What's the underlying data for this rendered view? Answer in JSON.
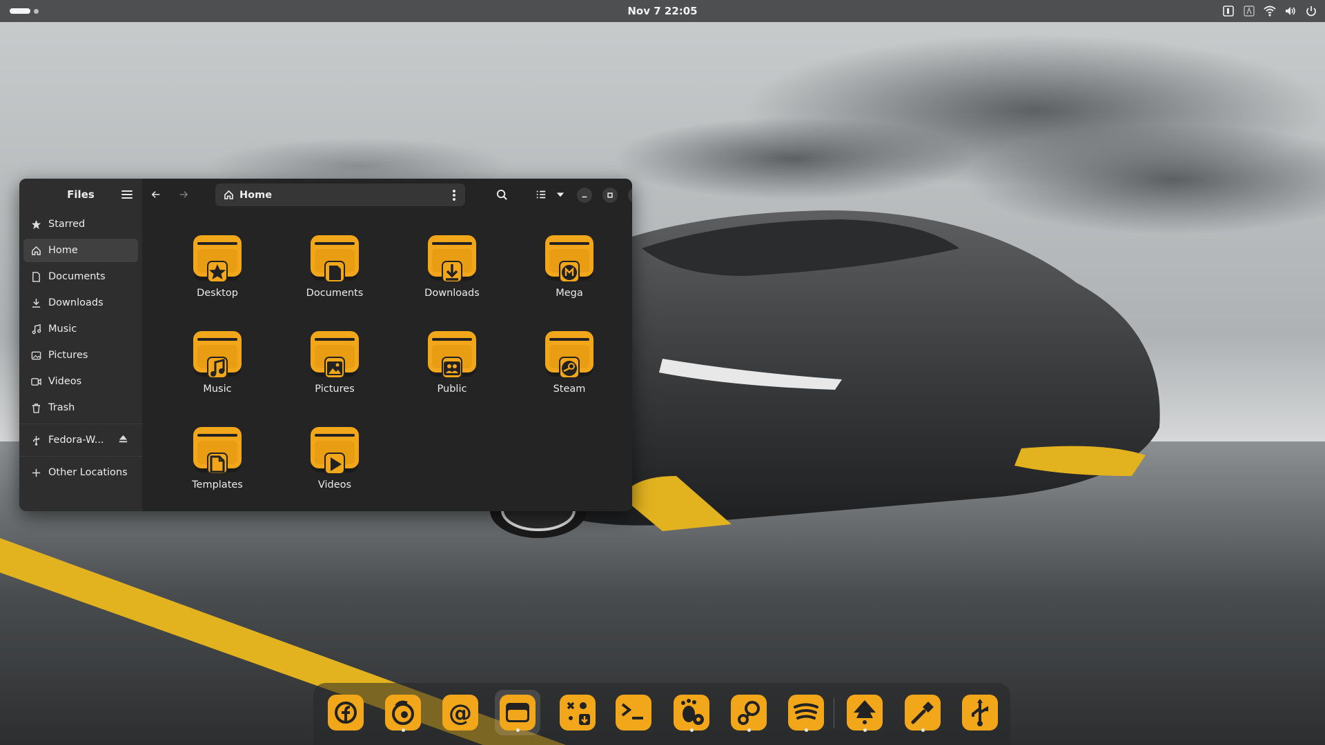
{
  "topbar": {
    "clock": "Nov 7  22:05",
    "tray_icons": [
      "keyboard-layout-icon",
      "input-method-icon",
      "wifi-icon",
      "volume-icon",
      "power-icon"
    ]
  },
  "files": {
    "title": "Files",
    "location": "Home",
    "sidebar": [
      {
        "label": "Starred",
        "icon": "star-icon"
      },
      {
        "label": "Home",
        "icon": "home-icon",
        "active": true
      },
      {
        "label": "Documents",
        "icon": "document-icon"
      },
      {
        "label": "Downloads",
        "icon": "download-icon"
      },
      {
        "label": "Music",
        "icon": "music-icon"
      },
      {
        "label": "Pictures",
        "icon": "picture-icon"
      },
      {
        "label": "Videos",
        "icon": "video-icon"
      },
      {
        "label": "Trash",
        "icon": "trash-icon"
      }
    ],
    "device": {
      "label": "Fedora-W...",
      "icon": "usb-icon"
    },
    "other_locations": "Other Locations",
    "folders": [
      {
        "label": "Desktop",
        "emblem": "star"
      },
      {
        "label": "Documents",
        "emblem": "document"
      },
      {
        "label": "Downloads",
        "emblem": "download"
      },
      {
        "label": "Mega",
        "emblem": "mega"
      },
      {
        "label": "Music",
        "emblem": "music"
      },
      {
        "label": "Pictures",
        "emblem": "picture"
      },
      {
        "label": "Public",
        "emblem": "people"
      },
      {
        "label": "Steam",
        "emblem": "steam"
      },
      {
        "label": "Templates",
        "emblem": "template"
      },
      {
        "label": "Videos",
        "emblem": "play"
      }
    ]
  },
  "dock": {
    "apps": [
      {
        "name": "fedora-icon",
        "running": false
      },
      {
        "name": "firefox-icon",
        "running": true
      },
      {
        "name": "mail-icon",
        "running": false
      },
      {
        "name": "files-icon",
        "running": true,
        "focused": true
      },
      {
        "name": "software-icon",
        "running": false
      },
      {
        "name": "terminal-icon",
        "running": false
      },
      {
        "name": "gnome-settings-icon",
        "running": true
      },
      {
        "name": "steam-icon",
        "running": true
      },
      {
        "name": "spotify-icon",
        "running": true
      },
      {
        "name": "inkscape-icon",
        "running": true
      },
      {
        "name": "color-picker-icon",
        "running": true
      },
      {
        "name": "usb-writer-icon",
        "running": false
      }
    ]
  },
  "colors": {
    "accent": "#f2a619",
    "accent_dark": "#d98c0a",
    "window_bg": "#242424",
    "sidebar_bg": "#2e2e2e"
  }
}
